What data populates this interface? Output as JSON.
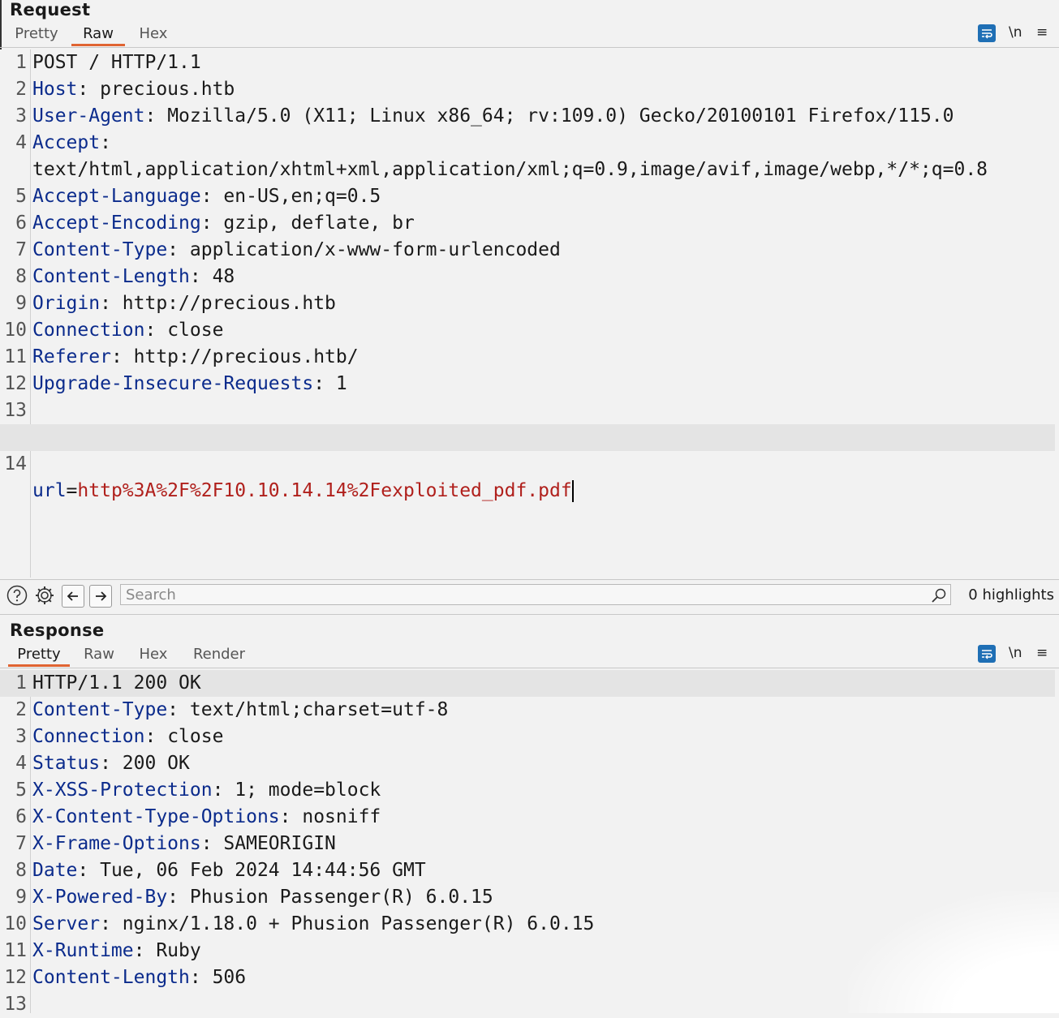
{
  "request": {
    "title": "Request",
    "tabs": [
      "Pretty",
      "Raw",
      "Hex"
    ],
    "active_tab": "Raw",
    "newline_label": "\\n",
    "menu_label": "≡",
    "lines": [
      {
        "num": "1",
        "name": "",
        "sep": "",
        "value": "POST / HTTP/1.1"
      },
      {
        "num": "2",
        "name": "Host",
        "sep": ": ",
        "value": "precious.htb"
      },
      {
        "num": "3",
        "name": "User-Agent",
        "sep": ": ",
        "value": "Mozilla/5.0 (X11; Linux x86_64; rv:109.0) Gecko/20100101 Firefox/115.0"
      },
      {
        "num": "4",
        "name": "Accept",
        "sep": ":",
        "value": ""
      },
      {
        "num": "",
        "name": "",
        "sep": "",
        "value": "text/html,application/xhtml+xml,application/xml;q=0.9,image/avif,image/webp,*/*;q=0.8"
      },
      {
        "num": "5",
        "name": "Accept-Language",
        "sep": ": ",
        "value": "en-US,en;q=0.5"
      },
      {
        "num": "6",
        "name": "Accept-Encoding",
        "sep": ": ",
        "value": "gzip, deflate, br"
      },
      {
        "num": "7",
        "name": "Content-Type",
        "sep": ": ",
        "value": "application/x-www-form-urlencoded"
      },
      {
        "num": "8",
        "name": "Content-Length",
        "sep": ": ",
        "value": "48"
      },
      {
        "num": "9",
        "name": "Origin",
        "sep": ": ",
        "value": "http://precious.htb"
      },
      {
        "num": "10",
        "name": "Connection",
        "sep": ": ",
        "value": "close"
      },
      {
        "num": "11",
        "name": "Referer",
        "sep": ": ",
        "value": "http://precious.htb/"
      },
      {
        "num": "12",
        "name": "Upgrade-Insecure-Requests",
        "sep": ": ",
        "value": "1"
      },
      {
        "num": "13",
        "name": "",
        "sep": "",
        "value": ""
      }
    ],
    "body_line": {
      "num": "14",
      "param": "url",
      "eq": "=",
      "value": "http%3A%2F%2F10.10.14.14%2Fexploited_pdf.pdf"
    }
  },
  "search": {
    "placeholder": "Search",
    "highlights": "0 highlights"
  },
  "response": {
    "title": "Response",
    "tabs": [
      "Pretty",
      "Raw",
      "Hex",
      "Render"
    ],
    "active_tab": "Pretty",
    "newline_label": "\\n",
    "menu_label": "≡",
    "lines": [
      {
        "num": "1",
        "name": "",
        "sep": "",
        "value": "HTTP/1.1 200 OK"
      },
      {
        "num": "2",
        "name": "Content-Type",
        "sep": ": ",
        "value": "text/html;charset=utf-8"
      },
      {
        "num": "3",
        "name": "Connection",
        "sep": ": ",
        "value": "close"
      },
      {
        "num": "4",
        "name": "Status",
        "sep": ": ",
        "value": "200 OK"
      },
      {
        "num": "5",
        "name": "X-XSS-Protection",
        "sep": ": ",
        "value": "1; mode=block"
      },
      {
        "num": "6",
        "name": "X-Content-Type-Options",
        "sep": ": ",
        "value": "nosniff"
      },
      {
        "num": "7",
        "name": "X-Frame-Options",
        "sep": ": ",
        "value": "SAMEORIGIN"
      },
      {
        "num": "8",
        "name": "Date",
        "sep": ": ",
        "value": "Tue, 06 Feb 2024 14:44:56 GMT"
      },
      {
        "num": "9",
        "name": "X-Powered-By",
        "sep": ": ",
        "value": "Phusion Passenger(R) 6.0.15"
      },
      {
        "num": "10",
        "name": "Server",
        "sep": ": ",
        "value": "nginx/1.18.0 + Phusion Passenger(R) 6.0.15"
      },
      {
        "num": "11",
        "name": "X-Runtime",
        "sep": ": ",
        "value": "Ruby"
      },
      {
        "num": "12",
        "name": "Content-Length",
        "sep": ": ",
        "value": "506"
      },
      {
        "num": "13",
        "name": "",
        "sep": "",
        "value": ""
      }
    ]
  },
  "colors": {
    "header_name": "#0b2b8c",
    "param_value": "#b0201c",
    "tab_accent": "#e06432",
    "wrap_button": "#1f6fb5"
  },
  "icons": [
    "help-icon",
    "gear-icon",
    "arrow-left-icon",
    "arrow-right-icon",
    "search-icon",
    "wrap-lines-icon",
    "menu-icon"
  ]
}
